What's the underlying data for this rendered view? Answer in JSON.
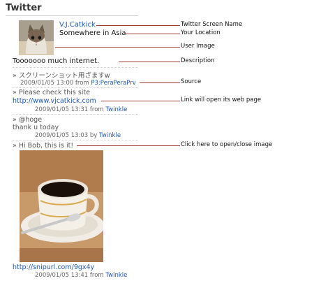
{
  "widget": {
    "title": "Twitter"
  },
  "profile": {
    "screen_name": "V.J.Catkick",
    "location": "Somewhere in Asia",
    "description": "Tooooooo much internet.",
    "avatar": "user-image-cat-photo"
  },
  "tweets": [
    {
      "marker": "»",
      "text": "スクリーンショット用ざますw",
      "time": "2009/01/05 13:00",
      "via_word": "from",
      "source": "P3:PeraPeraPrv"
    },
    {
      "marker": "»",
      "text": "Please check this site",
      "link": "http://www.vjcatkick.com",
      "time": "2009/01/05 13:31",
      "via_word": "from",
      "source": "Twinkle"
    },
    {
      "marker": "»",
      "text": "@hoge",
      "text2": "thank u today",
      "time": "2009/01/05 13:03",
      "via_word": "by",
      "source": "Twinkle"
    },
    {
      "marker": "»",
      "text": "Hi Bob, this is it!",
      "image": "coffee-cup-photo",
      "link": "http://snipurl.com/9gx4y",
      "time": "2009/01/05 13:41",
      "via_word": "from",
      "source": "Twinkle"
    }
  ],
  "callouts": {
    "screen_name": "Twitter Screen Name",
    "location": "Your Location",
    "user_image": "User Image",
    "description": "Description",
    "source": "Source",
    "link": "Link will open its web page",
    "image_toggle": "Click here to open/close image"
  },
  "colors": {
    "link": "#1d56a8",
    "callout_line": "#a33a3a",
    "text": "#222222"
  }
}
